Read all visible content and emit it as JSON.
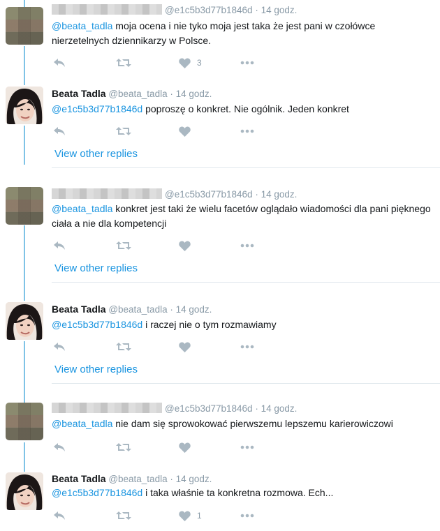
{
  "tweets": [
    {
      "author": "",
      "handle": "@e1c5b3d77b1846d",
      "time": "14 godz.",
      "mention": "@beata_tadla",
      "body": " moja ocena i nie tyko moja  jest taka że jest pani w czołówce nierzetelnych dziennikarzy w Polsce.",
      "like_count": "3"
    },
    {
      "author": "Beata Tadla",
      "handle": "@beata_tadla",
      "time": "14 godz.",
      "mention": "@e1c5b3d77b1846d",
      "body": " poproszę o konkret. Nie ogólnik. Jeden konkret",
      "like_count": "",
      "view_replies": "View other replies"
    },
    {
      "author": "",
      "handle": "@e1c5b3d77b1846d",
      "time": "14 godz.",
      "mention": "@beata_tadla",
      "body": " konkret jest taki że wielu facetów oglądało wiadomości dla pani pięknego ciała a nie dla kompetencji",
      "like_count": "",
      "view_replies": "View other replies"
    },
    {
      "author": "Beata Tadla",
      "handle": "@beata_tadla",
      "time": "14 godz.",
      "mention": "@e1c5b3d77b1846d",
      "body": " i raczej nie o tym rozmawiamy",
      "like_count": "",
      "view_replies": "View other replies"
    },
    {
      "author": "",
      "handle": "@e1c5b3d77b1846d",
      "time": "14 godz.",
      "mention": "@beata_tadla",
      "body": " nie dam się sprowokować pierwszemu lepszemu karierowiczowi",
      "like_count": ""
    },
    {
      "author": "Beata Tadla",
      "handle": "@beata_tadla",
      "time": "14 godz.",
      "mention": "@e1c5b3d77b1846d",
      "body": " i taka właśnie ta konkretna rozmowa. Ech...",
      "like_count": "1"
    }
  ],
  "separator": "·",
  "colors": {
    "link": "#1b95e0",
    "thread_line": "#7fc3e6",
    "icon": "#aab8c2"
  }
}
